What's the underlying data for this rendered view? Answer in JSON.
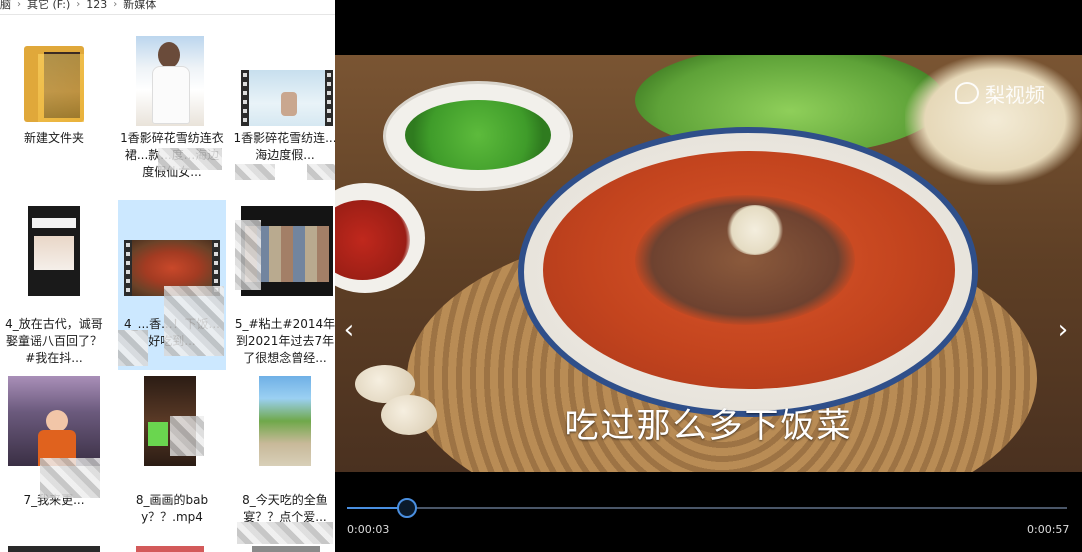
{
  "breadcrumb": {
    "items": [
      "脑",
      "其它 (F:)",
      "123",
      "新媒体"
    ],
    "separator": "›"
  },
  "files": [
    {
      "name": "新建文件夹",
      "type": "folder"
    },
    {
      "name": "1香影碎花雪纺连衣裙...款...度...海边度假仙女...",
      "type": "image"
    },
    {
      "name": "1香影碎花雪纺连...海边度假...",
      "type": "video"
    },
    {
      "name": "4_放在古代，诚哥娶童谣八百回了？#我在抖...",
      "type": "image"
    },
    {
      "name": "4_...香...！下饭...好吃到...",
      "type": "video",
      "selected": true
    },
    {
      "name": "5_#粘土#2014年到2021年过去7年了很想念曾经...",
      "type": "image"
    },
    {
      "name": "7_我来更...",
      "type": "image"
    },
    {
      "name": "8_画画的baby？？.mp4",
      "type": "image"
    },
    {
      "name": "8_今天吃的全鱼宴？？点个爱...",
      "type": "image"
    }
  ],
  "player": {
    "watermark": "梨视频",
    "subtitle": "吃过那么多下饭菜",
    "current_time": "0:00:03",
    "duration": "0:00:57",
    "progress": 0.08,
    "prev_icon": "chevron-left-icon",
    "next_icon": "chevron-right-icon",
    "accent_color": "#4a8fe0"
  }
}
